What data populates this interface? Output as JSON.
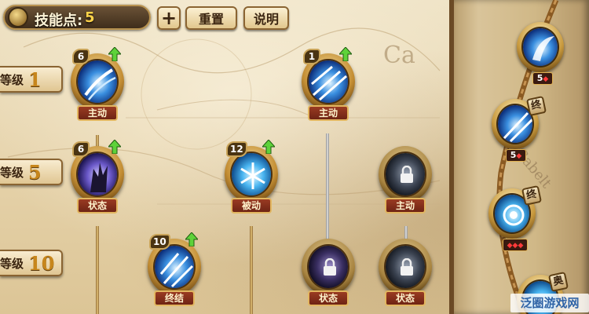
{
  "header": {
    "skill_points_label": "技能点:",
    "skill_points_value": "5",
    "add_label": "+",
    "reset_label": "重置",
    "help_label": "说明"
  },
  "levels": [
    {
      "label": "等级",
      "value": "1"
    },
    {
      "label": "等级",
      "value": "5"
    },
    {
      "label": "等级",
      "value": "10"
    }
  ],
  "skills": [
    {
      "count": "6",
      "tag": "主动",
      "icon": "ice-slash-icon",
      "upgradable": true,
      "locked": false
    },
    {
      "count": "1",
      "tag": "主动",
      "icon": "ice-shards-icon",
      "upgradable": true,
      "locked": false
    },
    {
      "count": "6",
      "tag": "状态",
      "icon": "shadow-claw-icon",
      "upgradable": true,
      "locked": false
    },
    {
      "count": "12",
      "tag": "被动",
      "icon": "snowflake-icon",
      "upgradable": true,
      "locked": false
    },
    {
      "count": "",
      "tag": "主动",
      "icon": "lock-icon",
      "upgradable": false,
      "locked": true
    },
    {
      "count": "10",
      "tag": "终结",
      "icon": "ice-trident-icon",
      "upgradable": true,
      "locked": false
    },
    {
      "count": "",
      "tag": "状态",
      "icon": "lock-icon",
      "upgradable": false,
      "locked": true
    },
    {
      "count": "",
      "tag": "状态",
      "icon": "lock-icon",
      "upgradable": false,
      "locked": true
    }
  ],
  "side_skills": [
    {
      "badge_value": "5",
      "badge_mark": "◆",
      "ultimate_label": ""
    },
    {
      "badge_value": "5",
      "badge_mark": "◆",
      "ultimate_label": "终"
    },
    {
      "badge_value": "",
      "badge_mark": "◆◆◆",
      "ultimate_label": "终"
    },
    {
      "badge_value": "",
      "badge_mark": "",
      "ultimate_label": "奥"
    }
  ],
  "map_text": [
    "Ca",
    "Gabelt"
  ],
  "watermark": "泛圈游戏网",
  "colors": {
    "parchment": "#e6d3ab",
    "gold": "#c7861c",
    "tag_red": "#9a3b22",
    "points_yellow": "#ffd34a"
  }
}
